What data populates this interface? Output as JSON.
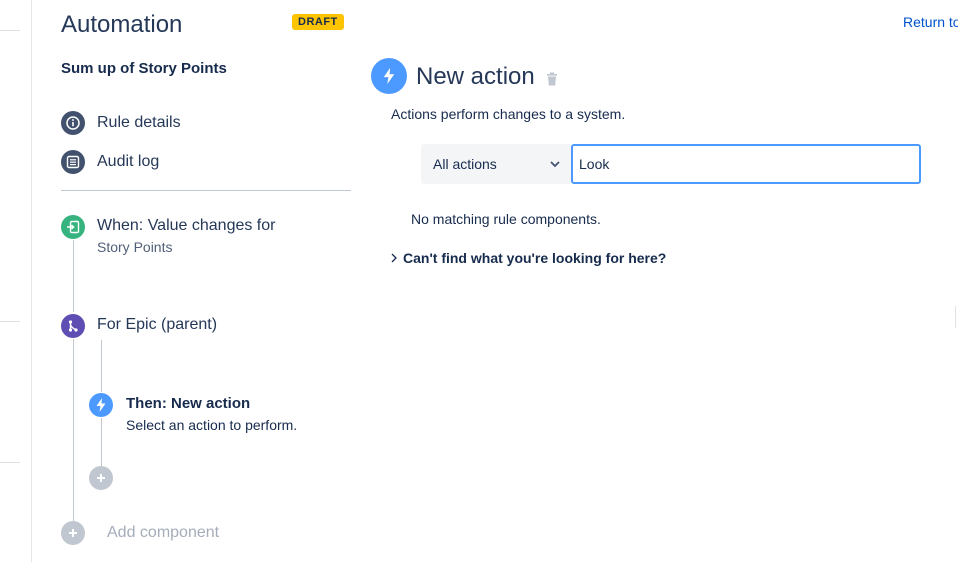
{
  "header": {
    "title": "Automation",
    "badge": "DRAFT",
    "return_link": "Return to"
  },
  "rule": {
    "name": "Sum up of Story Points",
    "menu": [
      {
        "label": "Rule details",
        "icon": "info-icon"
      },
      {
        "label": "Audit log",
        "icon": "list-icon"
      }
    ],
    "trigger": {
      "title": "When: Value changes for",
      "subtitle": "Story Points",
      "icon": "trigger-icon",
      "color": "#36b37e"
    },
    "branch": {
      "title": "For Epic (parent)",
      "icon": "branch-icon",
      "color": "#5e4db2"
    },
    "action": {
      "title": "Then: New action",
      "subtitle": "Select an action to perform.",
      "icon": "lightning-icon",
      "color": "#4c9aff"
    },
    "add_component": "Add component"
  },
  "main": {
    "title": "New action",
    "description": "Actions perform changes to a system.",
    "filter": {
      "selected": "All actions"
    },
    "search": {
      "value": "Look"
    },
    "empty_message": "No matching rule components.",
    "help_toggle": "Can't find what you're looking for here?"
  },
  "colors": {
    "accent": "#4c9aff",
    "link": "#0052cc",
    "badge": "#ffc400"
  }
}
